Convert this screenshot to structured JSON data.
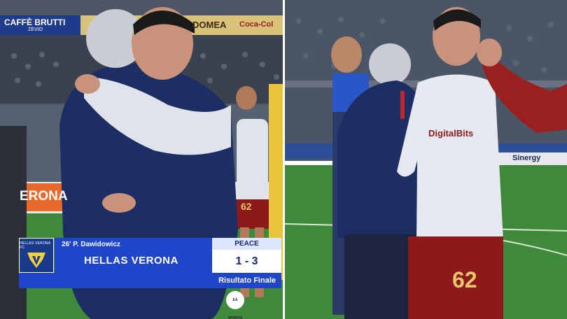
{
  "left_photo": {
    "ad_boards": [
      "CAFFÈ BRUTTI",
      "ZEVIO",
      "DOMEA",
      "Coca-Col"
    ],
    "led_board": "ERONA",
    "jersey_number": "62"
  },
  "scoreboard": {
    "crest_text": "HELLAS VERONA FC",
    "event": "26' P. Dawidowicz",
    "team": "HELLAS VERONA",
    "away_team": "PEACE",
    "score": "1 - 3",
    "status": "Risultato Finale",
    "broadcaster_logo": "EA SPORTS"
  },
  "right_photo": {
    "sponsor": "DigitalBits",
    "jersey_number": "62",
    "ad_board": "Sinergy"
  },
  "colors": {
    "scoreboard_blue": "#1f45c8",
    "roma_red": "#8c1a1a",
    "pitch_green": "#3e8a3a",
    "navy_jacket": "#1c2e63"
  }
}
